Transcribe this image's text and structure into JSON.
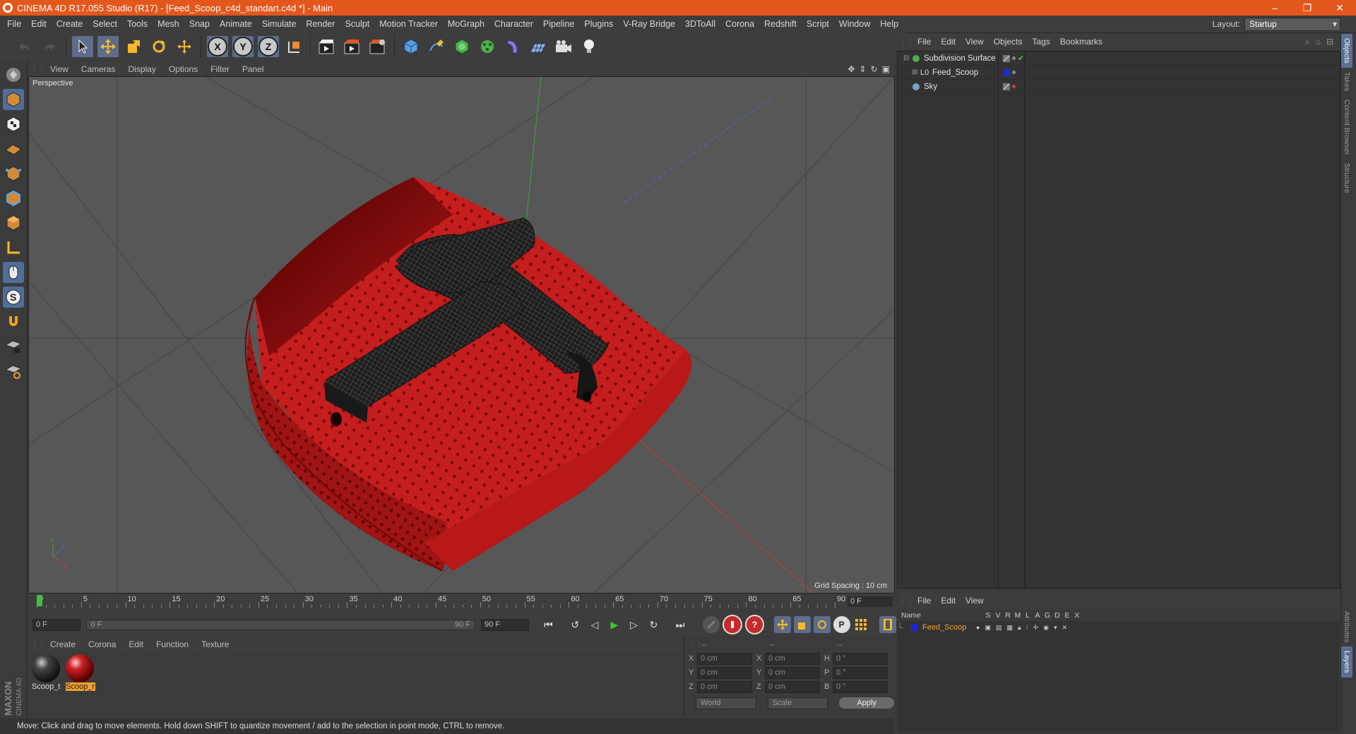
{
  "window": {
    "title": "CINEMA 4D R17.055 Studio (R17) - [Feed_Scoop_c4d_standart.c4d *] - Main",
    "minimize": "–",
    "maximize": "❐",
    "close": "✕"
  },
  "menubar": {
    "items": [
      "File",
      "Edit",
      "Create",
      "Select",
      "Tools",
      "Mesh",
      "Snap",
      "Animate",
      "Simulate",
      "Render",
      "Sculpt",
      "Motion Tracker",
      "MoGraph",
      "Character",
      "Pipeline",
      "Plugins",
      "V-Ray Bridge",
      "3DToAll",
      "Corona",
      "Redshift",
      "Script",
      "Window",
      "Help"
    ],
    "layout_label": "Layout:",
    "layout_value": "Startup"
  },
  "toolbar": {
    "axis_x": "X",
    "axis_y": "Y",
    "axis_z": "Z"
  },
  "viewport": {
    "menu": [
      "View",
      "Cameras",
      "Display",
      "Options",
      "Filter",
      "Panel"
    ],
    "label": "Perspective",
    "grid_spacing": "Grid Spacing : 10 cm"
  },
  "timeline": {
    "ticks": [
      "0",
      "5",
      "10",
      "15",
      "20",
      "25",
      "30",
      "35",
      "40",
      "45",
      "50",
      "55",
      "60",
      "65",
      "70",
      "75",
      "80",
      "85",
      "90"
    ],
    "current_frame": "0 F",
    "start_field": "0 F",
    "slider_start": "0 F",
    "slider_end": "90 F",
    "end_field": "90 F"
  },
  "materials": {
    "menu": [
      "Create",
      "Corona",
      "Edit",
      "Function",
      "Texture"
    ],
    "items": [
      {
        "name": "Scoop_t",
        "selected": false
      },
      {
        "name": "Scoop_r",
        "selected": true
      }
    ]
  },
  "coordinates": {
    "headers": [
      "--",
      "--",
      "--"
    ],
    "rows": [
      {
        "a": "X",
        "av": "0 cm",
        "b": "X",
        "bv": "0 cm",
        "c": "H",
        "cv": "0 °"
      },
      {
        "a": "Y",
        "av": "0 cm",
        "b": "Y",
        "bv": "0 cm",
        "c": "P",
        "cv": "0 °"
      },
      {
        "a": "Z",
        "av": "0 cm",
        "b": "Z",
        "bv": "0 cm",
        "c": "B",
        "cv": "0 °"
      }
    ],
    "mode1": "World",
    "mode2": "Scale",
    "apply": "Apply"
  },
  "status": "Move: Click and drag to move elements. Hold down SHIFT to quantize movement / add to the selection in point mode, CTRL to remove.",
  "objects": {
    "menu": [
      "File",
      "Edit",
      "View",
      "Objects",
      "Tags",
      "Bookmarks"
    ],
    "items": [
      {
        "name": "Subdivision Surface",
        "icon": "subdivision-icon",
        "color": "#48b048"
      },
      {
        "name": "Feed_Scoop",
        "icon": "null-object-icon",
        "color": "#1a2ad0"
      },
      {
        "name": "Sky",
        "icon": "sky-icon",
        "color": "#7aa0d0"
      }
    ]
  },
  "layers": {
    "menu": [
      "File",
      "Edit",
      "View"
    ],
    "columns": [
      "Name",
      "S",
      "V",
      "R",
      "M",
      "L",
      "A",
      "G",
      "D",
      "E",
      "X"
    ],
    "row_name": "Feed_Scoop"
  },
  "right_tabs": [
    "Objects",
    "Takes",
    "Content Browser",
    "Structure"
  ],
  "right_tabs_lower": [
    "Attributes",
    "Layers"
  ],
  "branding": {
    "line1": "MAXON",
    "line2": "CINEMA 4D"
  },
  "colors": {
    "accent": "#e4571c",
    "model_red": "#b01818",
    "selection_blue": "#5d6d8a"
  }
}
